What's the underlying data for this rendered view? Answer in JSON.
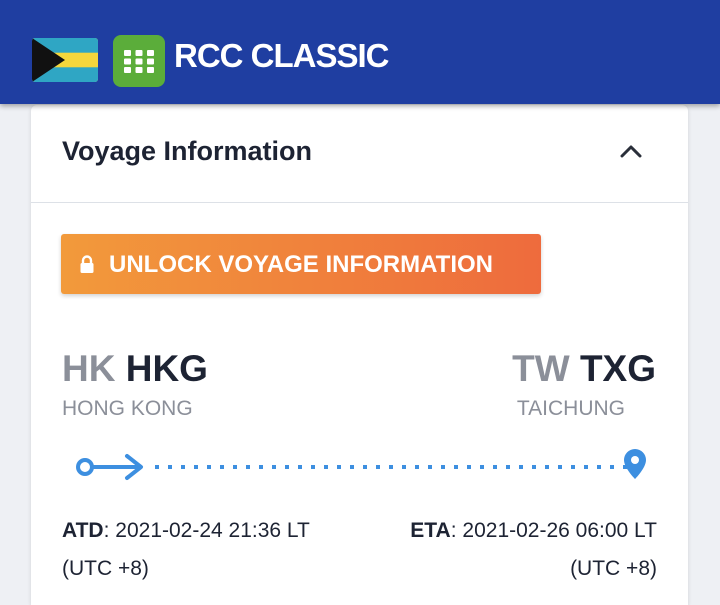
{
  "header": {
    "app_title": "RCC CLASSIC",
    "flag_icon": "bahamas-flag-icon",
    "app_icon": "grid-app-icon",
    "brand_color": "#1f3ea1"
  },
  "card": {
    "title": "Voyage Information",
    "collapse_icon": "chevron-up-icon",
    "unlock_button": {
      "label": "UNLOCK VOYAGE INFORMATION",
      "icon": "lock-icon",
      "gradient": [
        "#f29a3b",
        "#ee6b3d"
      ]
    },
    "departure": {
      "country_code": "HK",
      "port_code": "HKG",
      "port_name": "HONG KONG"
    },
    "arrival": {
      "country_code": "TW",
      "port_code": "TXG",
      "port_name": "TAICHUNG"
    },
    "route_color": "#3d8fe0",
    "atd": {
      "label": "ATD",
      "value": ": 2021-02-24 21:36 LT",
      "tz": "(UTC +8)"
    },
    "eta": {
      "label": "ETA",
      "value": ": 2021-02-26 06:00 LT",
      "tz": "(UTC +8)"
    }
  }
}
